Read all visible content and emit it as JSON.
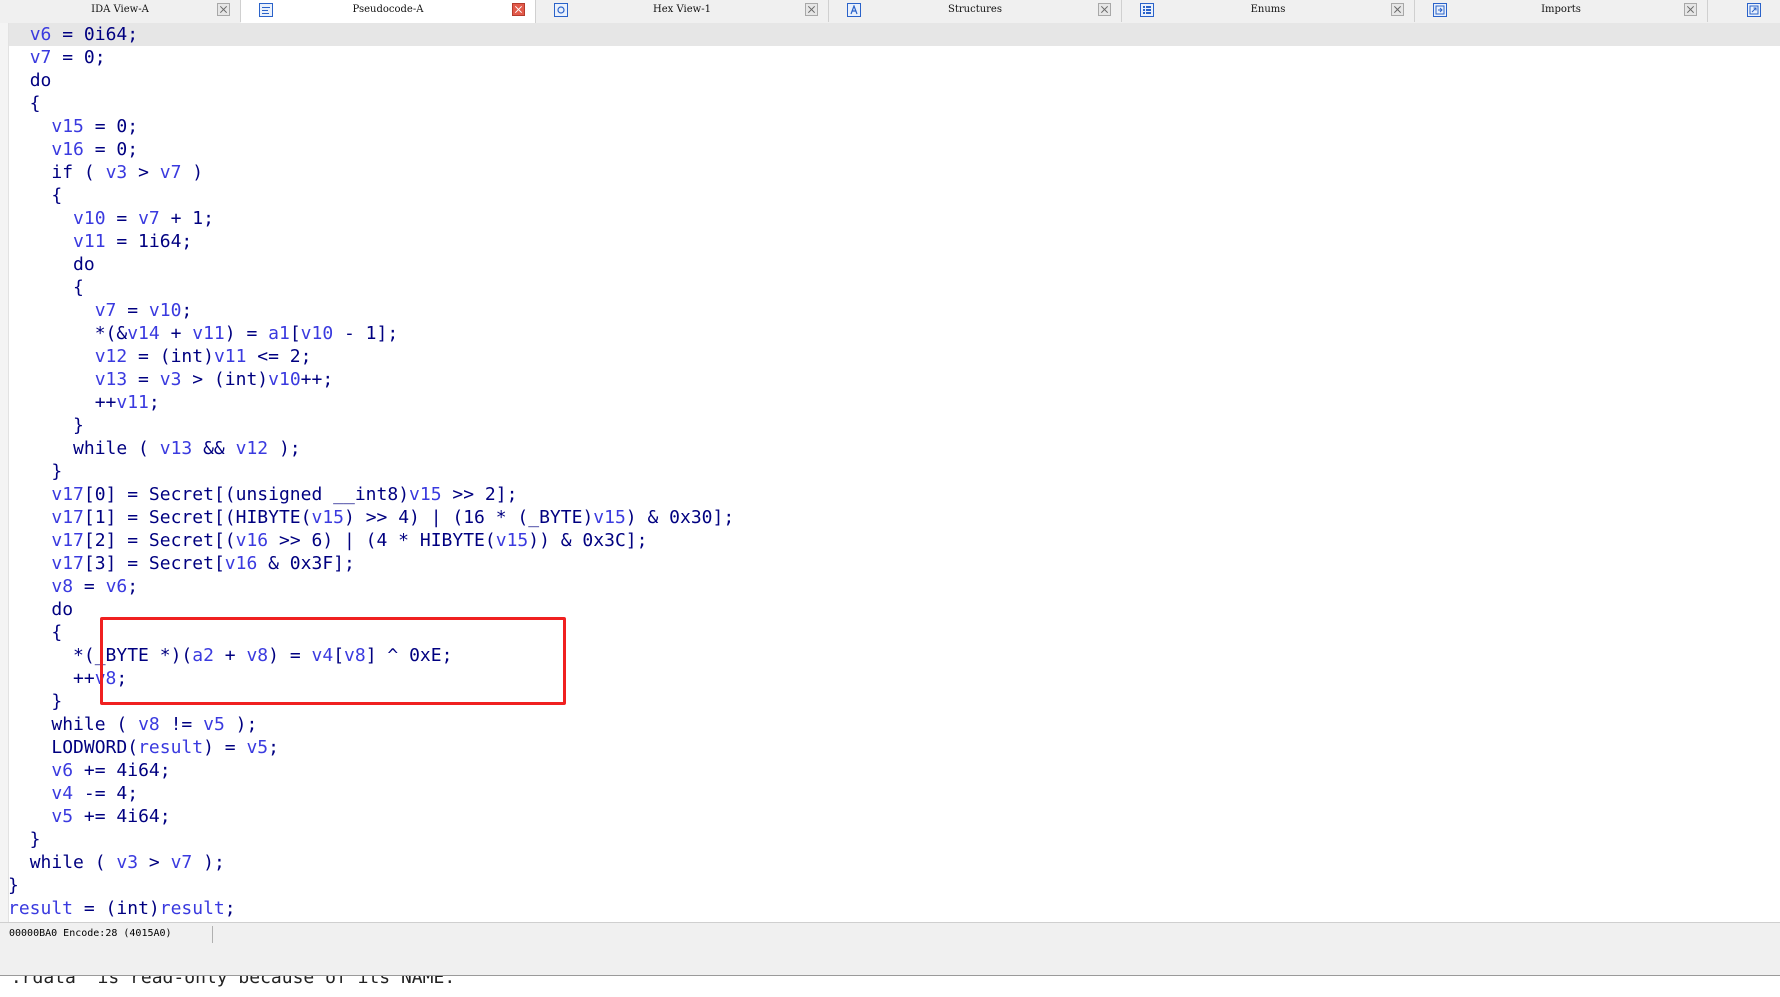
{
  "tabs": [
    {
      "label": "IDA View-A",
      "icon": "graph-view-icon",
      "active": false
    },
    {
      "label": "Pseudocode-A",
      "icon": "pseudocode-icon",
      "active": true
    },
    {
      "label": "Hex View-1",
      "icon": "hex-view-icon",
      "active": false
    },
    {
      "label": "Structures",
      "icon": "structures-icon",
      "active": false
    },
    {
      "label": "Enums",
      "icon": "enums-icon",
      "active": false
    },
    {
      "label": "Imports",
      "icon": "imports-icon",
      "active": false
    }
  ],
  "code_lines": [
    "  v6 = 0i64;",
    "  v7 = 0;",
    "  do",
    "  {",
    "    v15 = 0;",
    "    v16 = 0;",
    "    if ( v3 > v7 )",
    "    {",
    "      v10 = v7 + 1;",
    "      v11 = 1i64;",
    "      do",
    "      {",
    "        v7 = v10;",
    "        *(&v14 + v11) = a1[v10 - 1];",
    "        v12 = (int)v11 <= 2;",
    "        v13 = v3 > (int)v10++;",
    "        ++v11;",
    "      }",
    "      while ( v13 && v12 );",
    "    }",
    "    v17[0] = Secret[(unsigned __int8)v15 >> 2];",
    "    v17[1] = Secret[(HIBYTE(v15) >> 4) | (16 * (_BYTE)v15) & 0x30];",
    "    v17[2] = Secret[(v16 >> 6) | (4 * HIBYTE(v15)) & 0x3C];",
    "    v17[3] = Secret[v16 & 0x3F];",
    "    v8 = v6;",
    "    do",
    "    {",
    "      *(_BYTE *)(a2 + v8) = v4[v8] ^ 0xE;",
    "      ++v8;",
    "    }",
    "    while ( v8 != v5 );",
    "    LODWORD(result) = v5;",
    "    v6 += 4i64;",
    "    v4 -= 4;",
    "    v5 += 4i64;",
    "  }",
    "  while ( v3 > v7 );",
    "}",
    "result = (int)result;"
  ],
  "status_bar": {
    "text": "00000BA0 Encode:28 (4015A0)"
  },
  "output": {
    "text": "'.rdata' is read-only because of its NAME."
  },
  "colors": {
    "identifier": "#3a3adf",
    "keyword": "#000080",
    "highlight_box": "#f02020"
  }
}
